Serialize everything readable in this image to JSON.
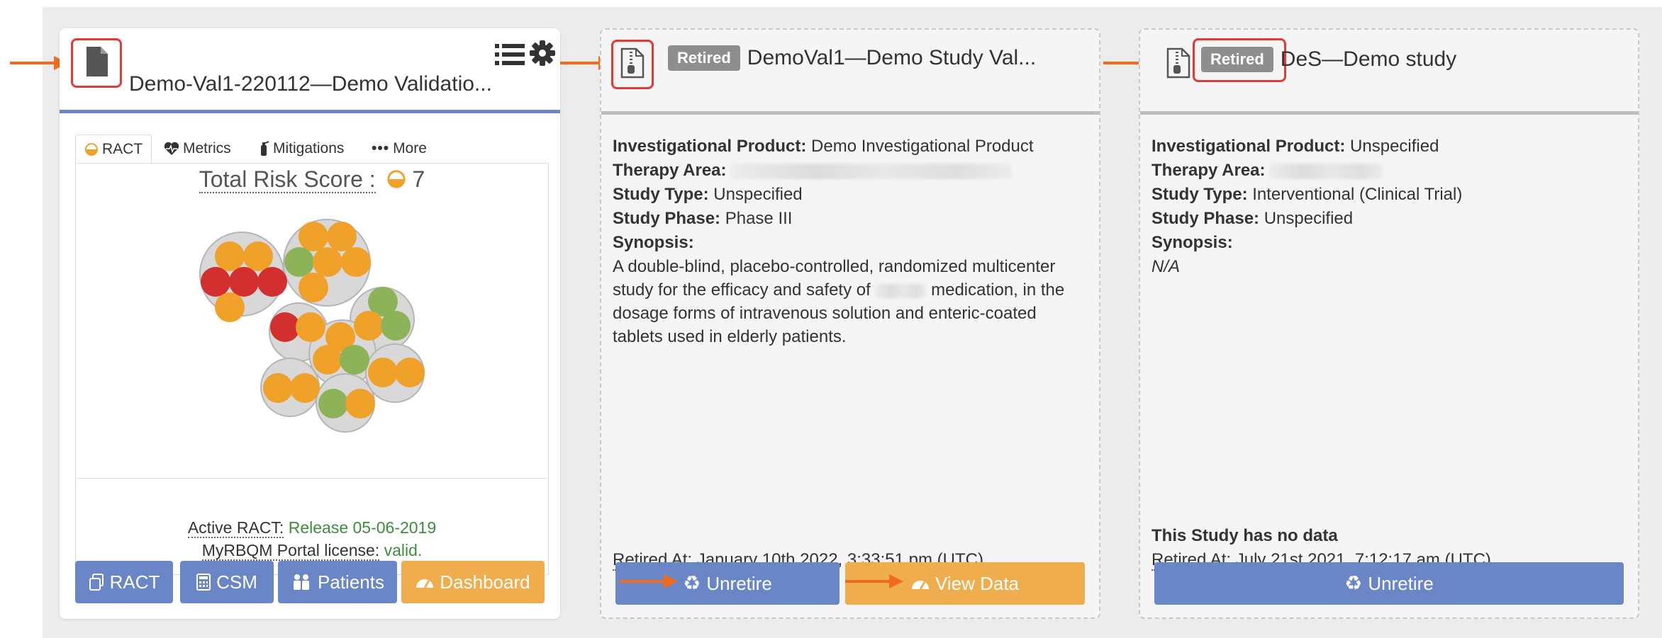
{
  "colors": {
    "accent": "#6b86c7",
    "warning": "#f0ad4e",
    "success": "#3c8d3c",
    "highlight": "#e53935",
    "arrow": "#f26b1d",
    "badge": "#8e8e8e"
  },
  "card1": {
    "title": "Demo-Val1-220112—Demo Validatio...",
    "icons": [
      "document-icon",
      "list-icon",
      "gear-icon"
    ],
    "tabs": [
      "RACT",
      "Metrics",
      "Mitigations",
      "More"
    ],
    "total_risk_label": "Total Risk Score :",
    "total_risk_value": "7",
    "risk_bubbles": {
      "groups": 7,
      "dot_levels": [
        "orange",
        "orange",
        "red",
        "red",
        "red",
        "orange",
        "orange",
        "orange",
        "green",
        "orange",
        "orange",
        "orange",
        "green",
        "orange",
        "green",
        "red",
        "orange",
        "orange",
        "orange",
        "green",
        "orange",
        "orange",
        "orange",
        "orange",
        "orange",
        "green",
        "orange"
      ]
    },
    "active_ract_label": "Active RACT:",
    "active_ract_value": "Release 05-06-2019",
    "license_label": "MyRBQM Portal license:",
    "license_value": "valid.",
    "buttons": [
      "RACT",
      "CSM",
      "Patients",
      "Dashboard"
    ]
  },
  "card2": {
    "badge": "Retired",
    "title": "DemoVal1—Demo Study Val...",
    "investigational_product_label": "Investigational Product:",
    "investigational_product": "Demo Investigational Product",
    "therapy_area_label": "Therapy Area:",
    "study_type_label": "Study Type:",
    "study_type": "Unspecified",
    "study_phase_label": "Study Phase:",
    "study_phase": "Phase III",
    "synopsis_label": "Synopsis:",
    "synopsis_part1": "A double-blind, placebo-controlled, randomized multicenter study for the efficacy and safety of",
    "synopsis_part2": "medication, in the dosage forms of intravenous solution and enteric-coated tablets used in elderly patients.",
    "retired_at_label": "Retired At:",
    "retired_at_value": "January 10th 2022, 3:33:51 pm (UTC)",
    "unretire_label": "Unretire",
    "view_data_label": "View Data"
  },
  "card3": {
    "badge": "Retired",
    "title": "DeS—Demo study",
    "investigational_product_label": "Investigational Product:",
    "investigational_product": "Unspecified",
    "therapy_area_label": "Therapy Area:",
    "study_type_label": "Study Type:",
    "study_type": "Interventional (Clinical Trial)",
    "study_phase_label": "Study Phase:",
    "study_phase": "Unspecified",
    "synopsis_label": "Synopsis:",
    "synopsis": "N/A",
    "no_data": "This Study has no data",
    "retired_at_label": "Retired At:",
    "retired_at_value": "July 21st 2021, 7:12:17 am (UTC)",
    "unretire_label": "Unretire"
  }
}
